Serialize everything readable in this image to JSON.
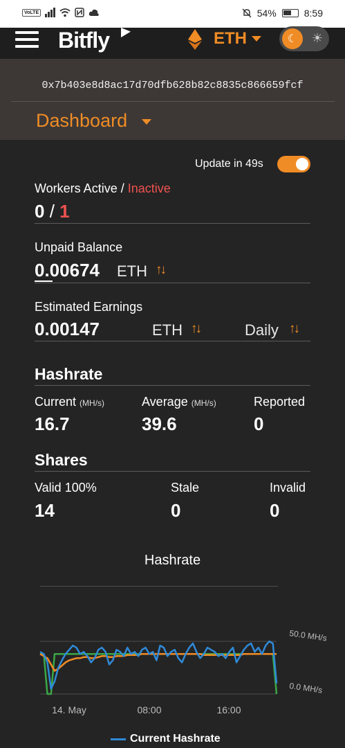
{
  "status_bar": {
    "volte": "VoLTE",
    "battery": "54%",
    "time": "8:59",
    "icons": [
      "signal-icon",
      "wifi-icon",
      "nfc-icon",
      "cloud-icon",
      "mute-icon",
      "battery-icon"
    ]
  },
  "app_bar": {
    "brand": "Bitfly",
    "coin": "ETH",
    "theme_icons": [
      "moon-icon",
      "sun-icon"
    ]
  },
  "address": "0x7b403e8d8ac17d70dfb628b82c8835c866659fcf",
  "page_menu": {
    "label": "Dashboard"
  },
  "update": {
    "text": "Update in 49s",
    "enabled": true
  },
  "workers": {
    "label_active": "Workers Active / ",
    "label_inactive": "Inactive",
    "active": "0",
    "separator": "/",
    "inactive": "1"
  },
  "unpaid": {
    "label": "Unpaid Balance",
    "value": "0.00674",
    "unit": "ETH"
  },
  "earnings": {
    "label": "Estimated Earnings",
    "value": "0.00147",
    "unit": "ETH",
    "period": "Daily"
  },
  "hashrate": {
    "title": "Hashrate",
    "current_label": "Current",
    "current_unit": "(MH/s)",
    "current_value": "16.7",
    "average_label": "Average",
    "average_unit": "(MH/s)",
    "average_value": "39.6",
    "reported_label": "Reported",
    "reported_value": "0"
  },
  "shares": {
    "title": "Shares",
    "valid_label": "Valid 100%",
    "valid_value": "14",
    "stale_label": "Stale",
    "stale_value": "0",
    "invalid_label": "Invalid",
    "invalid_value": "0"
  },
  "colors": {
    "accent": "#f08c25",
    "inactive": "#ef5350",
    "current": "#2f8ad8",
    "average": "#f08c25",
    "reported": "#3aa845"
  },
  "chart_data": {
    "type": "line",
    "title": "Hashrate",
    "x_ticks": [
      "14. May",
      "08:00",
      "16:00"
    ],
    "y_ticks": [
      "50.0 MH/s",
      "0.0 MH/s"
    ],
    "ylim": [
      0,
      50
    ],
    "legend": "bottom",
    "series": [
      {
        "name": "Current Hashrate",
        "color": "#2f8ad8",
        "values": [
          40,
          38,
          30,
          5,
          12,
          25,
          32,
          38,
          42,
          46,
          44,
          38,
          40,
          36,
          30,
          34,
          42,
          44,
          40,
          28,
          32,
          42,
          40,
          36,
          44,
          38,
          40,
          36,
          42,
          44,
          38,
          40,
          32,
          46,
          44,
          36,
          40,
          42,
          34,
          30,
          38,
          44,
          48,
          40,
          34,
          38,
          44,
          42,
          40,
          36,
          38,
          34,
          40,
          44,
          30,
          36,
          42,
          46,
          48,
          40,
          44,
          38,
          46,
          50,
          48,
          10
        ]
      },
      {
        "values": [
          38,
          36,
          34,
          28,
          22,
          24,
          27,
          30,
          32,
          33,
          34,
          34,
          35,
          35,
          34,
          34,
          35,
          36,
          36,
          35,
          35,
          36,
          36,
          36,
          37,
          37,
          37,
          37,
          38,
          38,
          38,
          38,
          38,
          38,
          38,
          38,
          38,
          38,
          38,
          38,
          38,
          38,
          38,
          38,
          38,
          37,
          37,
          37,
          37,
          37,
          37,
          37,
          37,
          37,
          37,
          37,
          38,
          38,
          38,
          38,
          38,
          38,
          38,
          38,
          38,
          38
        ]
      },
      {
        "values": [
          38,
          38,
          0,
          0,
          38,
          38,
          38,
          38,
          38,
          38,
          38,
          38,
          38,
          38,
          38,
          38,
          38,
          38,
          38,
          38,
          38,
          38,
          38,
          38,
          38,
          38,
          38,
          38,
          38,
          38,
          38,
          38,
          38,
          38,
          38,
          38,
          38,
          38,
          38,
          38,
          38,
          38,
          38,
          38,
          38,
          38,
          38,
          38,
          38,
          38,
          38,
          38,
          38,
          38,
          38,
          38,
          38,
          38,
          38,
          38,
          38,
          38,
          38,
          38,
          38,
          0
        ]
      }
    ]
  }
}
